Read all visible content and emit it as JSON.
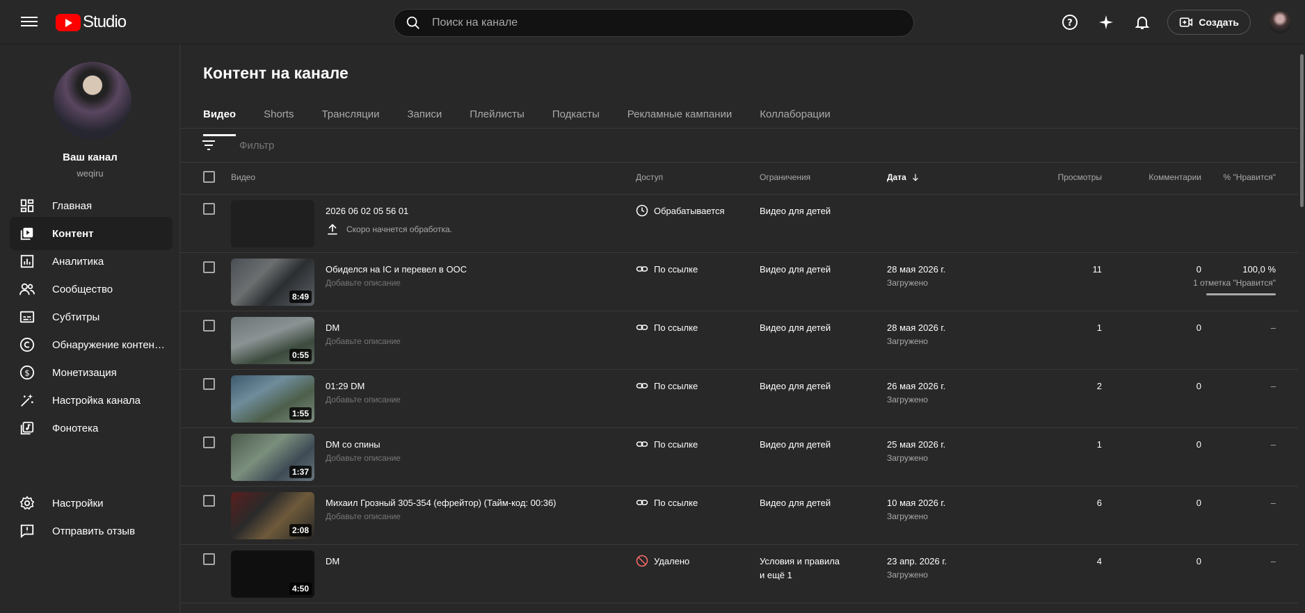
{
  "header": {
    "studio_label": "Studio",
    "search_placeholder": "Поиск на канале",
    "create_label": "Создать"
  },
  "sidebar": {
    "channel_title": "Ваш канал",
    "channel_handle": "weqiru",
    "items": [
      {
        "label": "Главная",
        "icon": "dashboard-icon"
      },
      {
        "label": "Контент",
        "icon": "content-icon",
        "active": true
      },
      {
        "label": "Аналитика",
        "icon": "analytics-icon"
      },
      {
        "label": "Сообщество",
        "icon": "community-icon"
      },
      {
        "label": "Субтитры",
        "icon": "subtitles-icon"
      },
      {
        "label": "Обнаружение контен…",
        "icon": "copyright-icon"
      },
      {
        "label": "Монетизация",
        "icon": "monetization-icon"
      },
      {
        "label": "Настройка канала",
        "icon": "customization-icon"
      },
      {
        "label": "Фонотека",
        "icon": "audio-library-icon"
      }
    ],
    "bottom_items": [
      {
        "label": "Настройки",
        "icon": "settings-icon"
      },
      {
        "label": "Отправить отзыв",
        "icon": "feedback-icon"
      }
    ]
  },
  "main": {
    "title": "Контент на канале",
    "tabs": [
      "Видео",
      "Shorts",
      "Трансляции",
      "Записи",
      "Плейлисты",
      "Подкасты",
      "Рекламные кампании",
      "Коллаборации"
    ],
    "filter_placeholder": "Фильтр",
    "columns": {
      "video": "Видео",
      "access": "Доступ",
      "restrictions": "Ограничения",
      "date": "Дата",
      "views": "Просмотры",
      "comments": "Комментарии",
      "likes": "% \"Нравится\""
    },
    "rows": [
      {
        "title": "2026 06 02 05 56 01",
        "desc": "Скоро начнется обработка.",
        "duration": "",
        "access": "Обрабатывается",
        "access_icon": "clock-icon",
        "restriction": "Видео для детей",
        "date": "",
        "date_sub": "",
        "views": "",
        "comments": "",
        "likes": "",
        "likes_sub": ""
      },
      {
        "title": "Обиделся на IC и перевел в ООС",
        "desc": "Добавьте описание",
        "duration": "8:49",
        "access": "По ссылке",
        "access_icon": "link-icon",
        "restriction": "Видео для детей",
        "date": "28 мая 2026 г.",
        "date_sub": "Загружено",
        "views": "11",
        "comments": "0",
        "likes": "100,0 %",
        "likes_sub": "1 отметка \"Нравится\""
      },
      {
        "title": "DM",
        "desc": "Добавьте описание",
        "duration": "0:55",
        "access": "По ссылке",
        "access_icon": "link-icon",
        "restriction": "Видео для детей",
        "date": "28 мая 2026 г.",
        "date_sub": "Загружено",
        "views": "1",
        "comments": "0",
        "likes": "–",
        "likes_sub": ""
      },
      {
        "title": "01:29 DM",
        "desc": "Добавьте описание",
        "duration": "1:55",
        "access": "По ссылке",
        "access_icon": "link-icon",
        "restriction": "Видео для детей",
        "date": "26 мая 2026 г.",
        "date_sub": "Загружено",
        "views": "2",
        "comments": "0",
        "likes": "–",
        "likes_sub": ""
      },
      {
        "title": "DM со спины",
        "desc": "Добавьте описание",
        "duration": "1:37",
        "access": "По ссылке",
        "access_icon": "link-icon",
        "restriction": "Видео для детей",
        "date": "25 мая 2026 г.",
        "date_sub": "Загружено",
        "views": "1",
        "comments": "0",
        "likes": "–",
        "likes_sub": ""
      },
      {
        "title": "Михаил Грозный 305-354 (ефрейтор) (Тайм-код: 00:36)",
        "desc": "Добавьте описание",
        "duration": "2:08",
        "access": "По ссылке",
        "access_icon": "link-icon",
        "restriction": "Видео для детей",
        "date": "10 мая 2026 г.",
        "date_sub": "Загружено",
        "views": "6",
        "comments": "0",
        "likes": "–",
        "likes_sub": ""
      },
      {
        "title": "DM",
        "desc": "",
        "duration": "4:50",
        "access": "Удалено",
        "access_icon": "blocked-icon",
        "restriction": "Условия и правила",
        "restriction_sub": "и ещё 1",
        "date": "23 апр. 2026 г.",
        "date_sub": "Загружено",
        "views": "4",
        "comments": "0",
        "likes": "–",
        "likes_sub": ""
      }
    ]
  },
  "colors": {
    "background": "#282828",
    "brand_red": "#ff0000",
    "removed_red": "#ff6b6b"
  }
}
